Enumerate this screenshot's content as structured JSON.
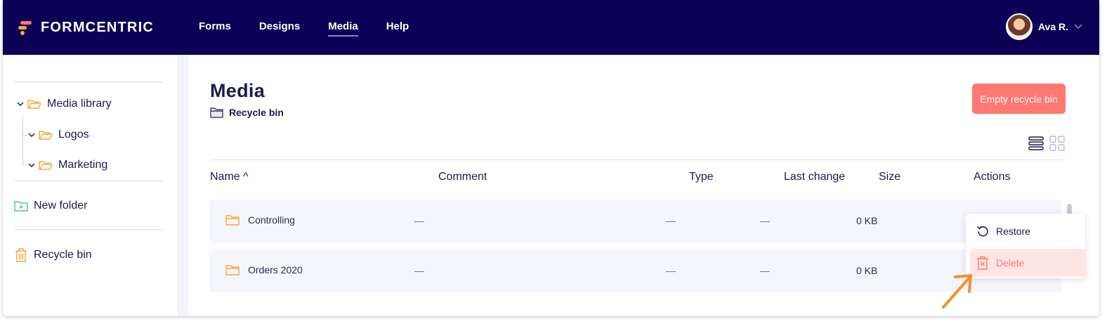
{
  "brand": {
    "name": "FORMCENTRIC"
  },
  "nav": {
    "items": [
      "Forms",
      "Designs",
      "Media",
      "Help"
    ],
    "active": "Media"
  },
  "user": {
    "name": "Ava R."
  },
  "sidebar": {
    "tree": [
      {
        "label": "Media library"
      },
      {
        "label": "Logos"
      },
      {
        "label": "Marketing"
      }
    ],
    "new_folder": "New folder",
    "recycle_bin": "Recycle bin"
  },
  "main": {
    "title": "Media",
    "breadcrumb": "Recycle bin",
    "empty_button": "Empty recycle bin",
    "columns": {
      "name": "Name ^",
      "comment": "Comment",
      "type": "Type",
      "last_change": "Last change",
      "size": "Size",
      "actions": "Actions"
    },
    "rows": [
      {
        "name": "Controlling",
        "comment": "—",
        "type": "—",
        "last_change": "—",
        "size": "0 KB"
      },
      {
        "name": "Orders 2020",
        "comment": "—",
        "type": "—",
        "last_change": "—",
        "size": "0 KB"
      }
    ],
    "menu": {
      "restore": "Restore",
      "delete": "Delete"
    }
  },
  "colors": {
    "topbar": "#0c0156",
    "accent": "#ff7871",
    "folder": "#f6a63a",
    "new_folder_icon": "#4cc38a"
  },
  "icons": {
    "list_view": "list-view-icon",
    "grid_view": "grid-view-icon",
    "annotation": "arrow-pointer"
  }
}
